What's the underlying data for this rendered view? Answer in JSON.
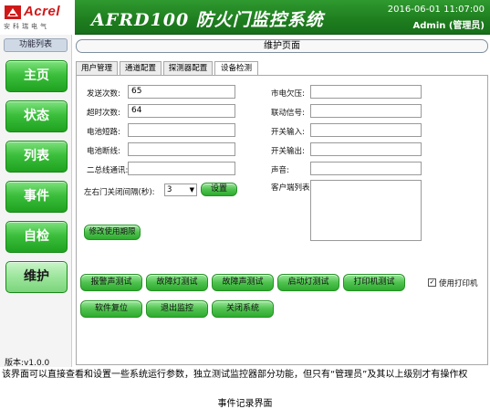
{
  "header": {
    "brand": "Acrel",
    "brand_cn": "安科瑞电气",
    "title": "AFRD100  防火门监控系统",
    "datetime": "2016-06-01 11:07:00",
    "user": "Admin (管理员)",
    "brand_color": "#d01818",
    "bar_color": "#1f7f1f"
  },
  "sidebar": {
    "title": "功能列表",
    "items": [
      {
        "label": "主页"
      },
      {
        "label": "状态"
      },
      {
        "label": "列表"
      },
      {
        "label": "事件"
      },
      {
        "label": "自检"
      },
      {
        "label": "维护",
        "active": true
      }
    ],
    "version": "版本:v1.0.0"
  },
  "page": {
    "title": "维护页面",
    "tabs": [
      {
        "label": "用户管理"
      },
      {
        "label": "通道配置"
      },
      {
        "label": "探测器配置"
      },
      {
        "label": "设备检测",
        "active": true
      }
    ]
  },
  "form": {
    "send_count_label": "发送次数:",
    "send_count_value": "65",
    "timeout_count_label": "超时次数:",
    "timeout_count_value": "64",
    "battery_short_label": "电池短路:",
    "battery_break_label": "电池断线:",
    "bus_comm_label": "二总线通讯:",
    "close_interval_label": "左右门关闭间隔(秒):",
    "close_interval_value": "3",
    "set_button": "设置",
    "modify_button": "修改使用期限",
    "mains_under_label": "市电欠压:",
    "linkage_signal_label": "联动信号:",
    "switch_in_label": "开关输入:",
    "switch_out_label": "开关输出:",
    "sound_label": "声音:",
    "client_list_label": "客户端列表:"
  },
  "tests": {
    "row1": [
      "报警声测试",
      "故障灯测试",
      "故障声测试",
      "启动灯测试",
      "打印机测试"
    ],
    "row2": [
      "软件复位",
      "退出监控",
      "关闭系统"
    ],
    "use_printer_label": "使用打印机",
    "use_printer_checked": true
  },
  "caption": {
    "text": "该界面可以直接查看和设置一些系统运行参数，独立测试监控器部分功能，但只有“管理员”及其以上级别才有操作权",
    "figure_title": "事件记录界面"
  }
}
